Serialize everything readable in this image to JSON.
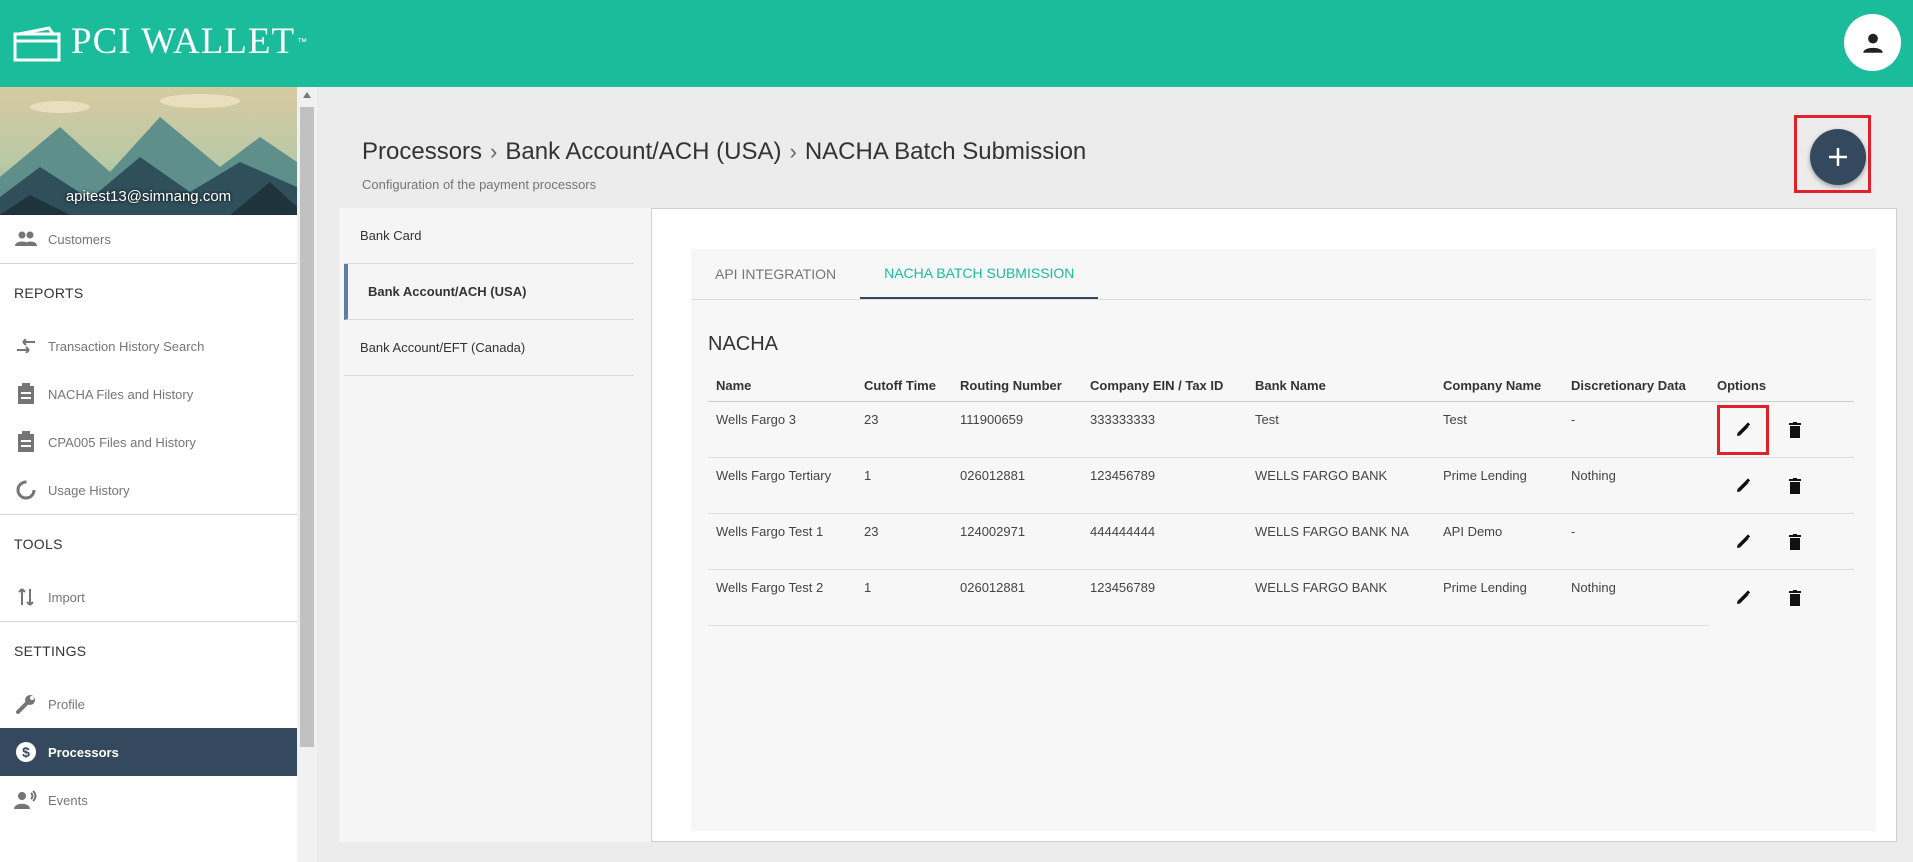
{
  "app": {
    "name": "PCI WALLET",
    "trademark": "™"
  },
  "user": {
    "email": "apitest13@simnang.com"
  },
  "sidebar": {
    "items_top": [
      {
        "label": "Customers",
        "icon": "people-icon"
      }
    ],
    "reports_header": "REPORTS",
    "reports": [
      {
        "label": "Transaction History Search",
        "icon": "swap-arrows-icon"
      },
      {
        "label": "NACHA Files and History",
        "icon": "clipboard-icon"
      },
      {
        "label": "CPA005 Files and History",
        "icon": "clipboard-icon"
      },
      {
        "label": "Usage History",
        "icon": "donut-icon"
      }
    ],
    "tools_header": "TOOLS",
    "tools": [
      {
        "label": "Import",
        "icon": "import-arrows-icon"
      }
    ],
    "settings_header": "SETTINGS",
    "settings": [
      {
        "label": "Profile",
        "icon": "wrench-icon"
      },
      {
        "label": "Processors",
        "icon": "dollar-circle-icon",
        "active": true
      },
      {
        "label": "Events",
        "icon": "person-broadcast-icon"
      }
    ]
  },
  "page": {
    "breadcrumb": [
      "Processors",
      "Bank Account/ACH (USA)",
      "NACHA Batch Submission"
    ],
    "breadcrumb_separator": "›",
    "subtitle": "Configuration of the payment processors"
  },
  "processors": [
    "Bank Card",
    "Bank Account/ACH (USA)",
    "Bank Account/EFT (Canada)"
  ],
  "tabs": [
    "API INTEGRATION",
    "NACHA BATCH SUBMISSION"
  ],
  "section_title": "NACHA",
  "table": {
    "headers": [
      "Name",
      "Cutoff Time",
      "Routing Number",
      "Company EIN / Tax ID",
      "Bank Name",
      "Company Name",
      "Discretionary Data",
      "Options"
    ],
    "rows": [
      [
        "Wells Fargo 3",
        "23",
        "111900659",
        "333333333",
        "Test",
        "Test",
        "-"
      ],
      [
        "Wells Fargo Tertiary",
        "1",
        "026012881",
        "123456789",
        "WELLS FARGO BANK",
        "Prime Lending",
        "Nothing"
      ],
      [
        "Wells Fargo Test 1",
        "23",
        "124002971",
        "444444444",
        "WELLS FARGO BANK NA",
        "API Demo",
        "-"
      ],
      [
        "Wells Fargo Test 2",
        "1",
        "026012881",
        "123456789",
        "WELLS FARGO BANK",
        "Prime Lending",
        "Nothing"
      ]
    ]
  },
  "colors": {
    "topbar": "#1abc9c",
    "accent_dark": "#34495e",
    "highlight": "#e0212b"
  }
}
